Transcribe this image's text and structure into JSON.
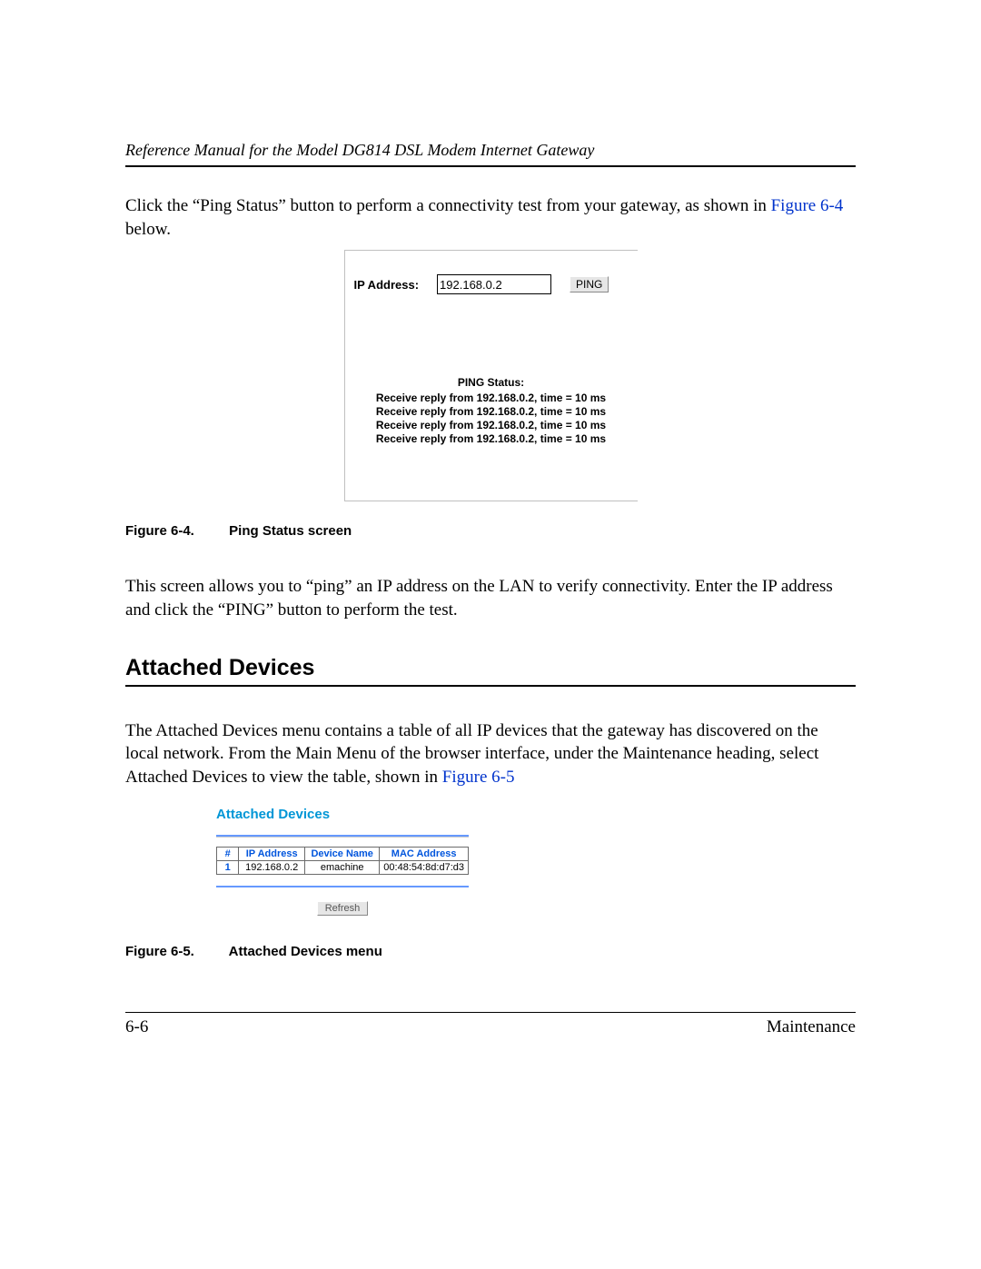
{
  "header": {
    "title": "Reference Manual for the Model DG814 DSL Modem Internet Gateway"
  },
  "intro_para": {
    "text_a": "Click the “Ping Status” button to perform a connectivity test from your gateway, as shown in ",
    "link": "Figure 6-4",
    "text_b": " below."
  },
  "ping_figure": {
    "ip_label": "IP Address:",
    "ip_value": "192.168.0.2",
    "ping_button": "PING",
    "status_title": "PING Status:",
    "replies": [
      "Receive reply from 192.168.0.2, time = 10 ms",
      "Receive reply from 192.168.0.2, time = 10 ms",
      "Receive reply from 192.168.0.2, time = 10 ms",
      "Receive reply from 192.168.0.2, time = 10 ms"
    ]
  },
  "figure64_caption": {
    "num": "Figure 6-4.",
    "title": "Ping Status screen"
  },
  "mid_para": "This screen allows you to “ping” an IP address on the LAN to verify connectivity. Enter the IP address and click the “PING” button to perform the test.",
  "section_heading": "Attached Devices",
  "attached_intro": {
    "text_a": "The Attached Devices menu contains a table of all IP devices that the gateway has discovered on the local network. From the Main Menu of the browser interface, under the Maintenance heading, select Attached Devices to view the table, shown in ",
    "link": "Figure 6-5"
  },
  "attached_figure": {
    "title": "Attached Devices",
    "headers": {
      "num": "#",
      "ip": "IP Address",
      "name": "Device Name",
      "mac": "MAC Address"
    },
    "rows": [
      {
        "num": "1",
        "ip": "192.168.0.2",
        "name": "emachine",
        "mac": "00:48:54:8d:d7:d3"
      }
    ],
    "refresh": "Refresh"
  },
  "figure65_caption": {
    "num": "Figure 6-5.",
    "title": "Attached Devices menu"
  },
  "footer": {
    "page": "6-6",
    "section": "Maintenance"
  }
}
